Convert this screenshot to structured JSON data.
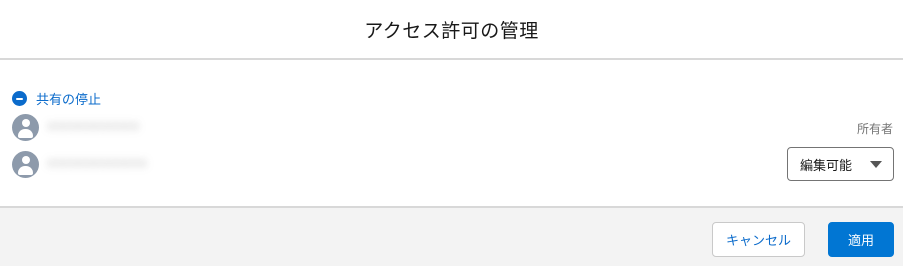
{
  "dialog": {
    "title": "アクセス許可の管理"
  },
  "stop_sharing": {
    "label": "共有の停止",
    "icon": "minus-circle-icon",
    "color": "#0b6bcb"
  },
  "users": [
    {
      "name_obscured": "xxxxxxxxxxxx",
      "role": "所有者",
      "icon": "user-avatar-icon"
    },
    {
      "name_obscured": "xxxxxxxxxxxxx",
      "access_level": "編集可能",
      "icon": "user-avatar-icon"
    }
  ],
  "footer": {
    "cancel_label": "キャンセル",
    "apply_label": "適用"
  },
  "colors": {
    "accent": "#0176d3",
    "link": "#0b6bcb",
    "avatar": "#8d9aab",
    "footer_bg": "#f3f3f3"
  }
}
